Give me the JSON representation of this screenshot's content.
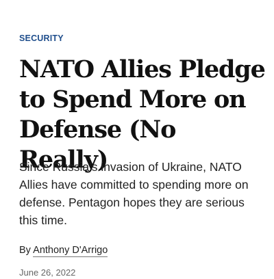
{
  "article": {
    "kicker": "SECURITY",
    "headline": "NATO Allies Pledge to Spend More on Defense (No Really)",
    "dek": "Since Russia’s invasion of Ukraine, NATO Allies have committed to spending more on defense. Pentagon hopes they are serious this time.",
    "byline_prefix": "By ",
    "author": "Anthony D'Arrigo",
    "date": "June 26, 2022"
  },
  "colors": {
    "kicker": "#1f4e8c",
    "headline": "#111111",
    "body": "#222222",
    "muted": "#666666",
    "background": "#ffffff"
  }
}
